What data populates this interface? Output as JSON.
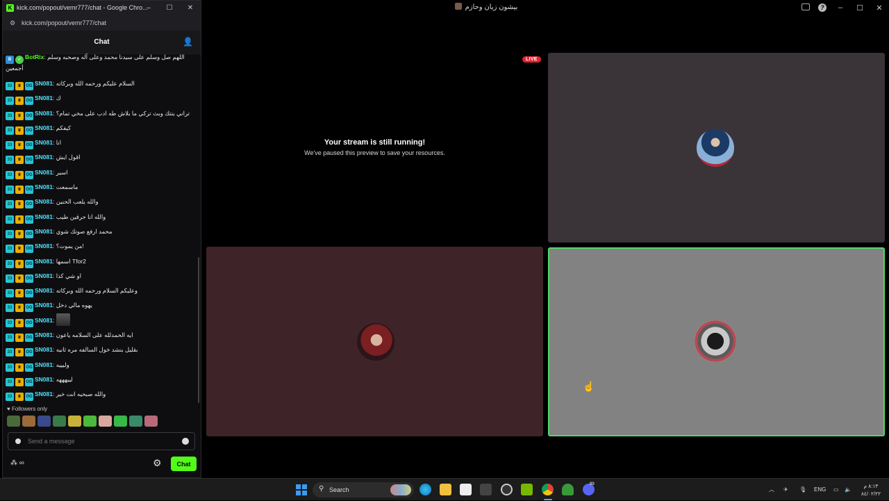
{
  "main_window": {
    "title": "بيشون زيان وحازم",
    "controls": {
      "minimize": "–",
      "maximize": "☐",
      "close": "✕"
    },
    "live_badge": "LIVE",
    "preview": {
      "title": "Your stream is still running!",
      "subtitle": "We've paused this preview to save your resources."
    }
  },
  "chat_window": {
    "title": "kick.com/popout/vemr777/chat - Google Chro...",
    "url": "kick.com/popout/vemr777/chat",
    "controls": {
      "minimize": "–",
      "maximize": "☐",
      "close": "✕"
    },
    "header_title": "Chat",
    "messages": [
      {
        "user": "BotRix",
        "text": "اللهم صل وسلم على سيدنا محمد وعلى آله وصحبه وسلم أجمعين",
        "type": "bot"
      },
      {
        "user": "SN081",
        "text": "السلام عليكم ورحمه الله وبركاته"
      },
      {
        "user": "SN081",
        "text": "ك"
      },
      {
        "user": "SN081",
        "text": "تراني بنتك وبث تركي ما بلاش طه ادب على مخي تمام؟"
      },
      {
        "user": "SN081",
        "text": "كيفكم"
      },
      {
        "user": "SN081",
        "text": "انا"
      },
      {
        "user": "SN081",
        "text": "اقول ايش"
      },
      {
        "user": "SN081",
        "text": "اسير"
      },
      {
        "user": "SN081",
        "text": "ماسمعت"
      },
      {
        "user": "SN081",
        "text": "والله يلعب الحنين"
      },
      {
        "user": "SN081",
        "text": "والله انا حرقين طيب"
      },
      {
        "user": "SN081",
        "text": "محمد ارفع صوتك شوي"
      },
      {
        "user": "SN081",
        "text": "من يموت؟!"
      },
      {
        "user": "SN081",
        "text": "اسمها Tfor2"
      },
      {
        "user": "SN081",
        "text": "او شي كذا"
      },
      {
        "user": "SN081",
        "text": "وعليكم السلام ورحمه الله وبركاته"
      },
      {
        "user": "SN081",
        "text": "يهوه مالي دخل"
      },
      {
        "user": "SN081",
        "text": "",
        "emote": true
      },
      {
        "user": "SN081",
        "text": "ايه الحمدلله على السلامه ياعون"
      },
      {
        "user": "SN081",
        "text": "بقليل بنشد خول السالفه مره ثانيه"
      },
      {
        "user": "SN081",
        "text": "وليييه"
      },
      {
        "user": "SN081",
        "text": "لييهههه"
      },
      {
        "user": "SN081",
        "text": "والله صبحيه انت خير"
      }
    ],
    "followers_only": "♥ Followers only",
    "input_placeholder": "Send a message",
    "footer_left": "∞",
    "chat_button": "Chat"
  },
  "taskbar": {
    "search_label": "Search",
    "language": "ENG",
    "time": "٨:١٣ م",
    "date": "٨٤/٠٢/٢٢",
    "notification_count": "99"
  },
  "colors": {
    "kick_green": "#53fc18",
    "live_red": "#e0242f",
    "username_cyan": "#4fe3ff",
    "speaking_border": "#53d769"
  }
}
